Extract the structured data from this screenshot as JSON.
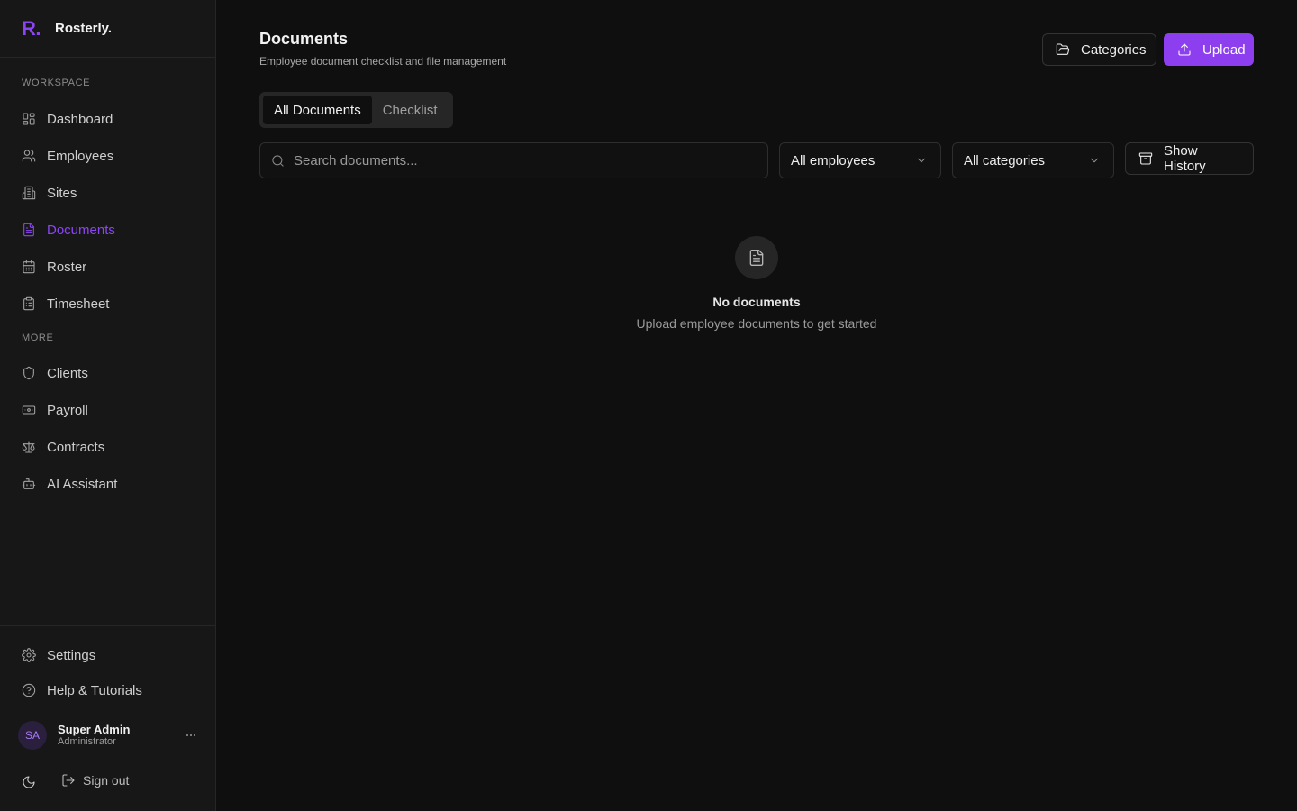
{
  "brand": {
    "logo": "R.",
    "name": "Rosterly."
  },
  "sidebar": {
    "workspace_label": "WORKSPACE",
    "workspace_items": [
      {
        "label": "Dashboard",
        "icon": "dashboard-icon"
      },
      {
        "label": "Employees",
        "icon": "users-icon"
      },
      {
        "label": "Sites",
        "icon": "building-icon"
      },
      {
        "label": "Documents",
        "icon": "document-icon",
        "active": true
      },
      {
        "label": "Roster",
        "icon": "calendar-icon"
      },
      {
        "label": "Timesheet",
        "icon": "clipboard-icon"
      }
    ],
    "more_label": "MORE",
    "more_items": [
      {
        "label": "Clients",
        "icon": "shield-icon"
      },
      {
        "label": "Payroll",
        "icon": "banknote-icon"
      },
      {
        "label": "Contracts",
        "icon": "scale-icon"
      },
      {
        "label": "AI Assistant",
        "icon": "bot-icon"
      }
    ],
    "settings_label": "Settings",
    "help_label": "Help & Tutorials",
    "user": {
      "initials": "SA",
      "name": "Super Admin",
      "role": "Administrator"
    },
    "signout_label": "Sign out"
  },
  "header": {
    "title": "Documents",
    "subtitle": "Employee document checklist and file management",
    "categories_label": "Categories",
    "upload_label": "Upload"
  },
  "tabs": [
    {
      "label": "All Documents",
      "active": true
    },
    {
      "label": "Checklist",
      "active": false
    }
  ],
  "filters": {
    "search_placeholder": "Search documents...",
    "employee_select": "All employees",
    "category_select": "All categories",
    "history_label": "Show History"
  },
  "empty_state": {
    "title": "No documents",
    "message": "Upload employee documents to get started"
  },
  "colors": {
    "accent": "#8d3ff0",
    "background": "#0f0f0f",
    "sidebar": "#171717"
  }
}
